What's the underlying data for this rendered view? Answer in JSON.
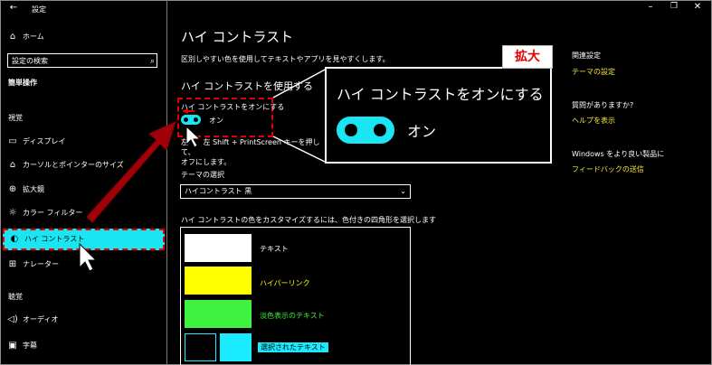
{
  "titlebar": {
    "back_icon": "back-arrow-icon",
    "title": "設定",
    "minimize_icon": "minimize-icon",
    "restore_icon": "restore-icon",
    "close_icon": "close-icon"
  },
  "sidebar": {
    "home": "ホーム",
    "search_placeholder": "設定の検索",
    "category": "簡単操作",
    "section_vision": "視覚",
    "items": [
      {
        "label": "ディスプレイ",
        "icon": "display-icon"
      },
      {
        "label": "カーソルとポインターのサイズ",
        "icon": "cursor-icon"
      },
      {
        "label": "拡大鏡",
        "icon": "magnifier-icon"
      },
      {
        "label": "カラー フィルター",
        "icon": "color-filter-icon"
      },
      {
        "label": "ハイ コントラスト",
        "icon": "high-contrast-icon",
        "selected": true
      },
      {
        "label": "ナレーター",
        "icon": "narrator-icon"
      }
    ],
    "section_hearing": "聴覚",
    "hearing_items": [
      {
        "label": "オーディオ",
        "icon": "audio-icon"
      },
      {
        "label": "字幕",
        "icon": "captions-icon"
      }
    ]
  },
  "main": {
    "title": "ハイ コントラスト",
    "description": "区別しやすい色を使用してテキストやアプリを見やすくします。",
    "use_heading": "ハイ コントラストを使用する",
    "toggle_label": "ハイ コントラストをオンにする",
    "toggle_state": "オン",
    "shortcut_line1": "左",
    "shortcut_line1b": "左 Shift + PrintScreen キーを押して、",
    "shortcut_line2": "オフにします。",
    "theme_label": "テーマの選択",
    "theme_value": "ハイコントラスト 黒",
    "customize_label": "ハイ コントラストの色をカスタマイズするには、色付きの四角形を選択します",
    "swatches": [
      {
        "label": "テキスト",
        "color": "#ffffff",
        "label_color": "#ffffff"
      },
      {
        "label": "ハイパーリンク",
        "color": "#ffff00",
        "label_color": "#ffff00"
      },
      {
        "label": "淡色表示のテキスト",
        "color": "#3ff23f",
        "label_color": "#3ff23f"
      },
      {
        "label": "選択されたテキスト",
        "color": "#1aebff",
        "label_color": "#000000"
      }
    ]
  },
  "zoom": {
    "tag": "拡大",
    "title": "ハイ コントラストをオンにする",
    "state": "オン"
  },
  "related": {
    "title": "関連設定",
    "theme_link": "テーマの設定",
    "question_title": "質問がありますか?",
    "help_link": "ヘルプを表示",
    "feedback_title": "Windows をより良い製品に",
    "feedback_link": "フィードバックの送信"
  },
  "colors": {
    "accent": "#1ae5f2",
    "highlight_red": "#e40000",
    "link": "#f4e63a"
  }
}
